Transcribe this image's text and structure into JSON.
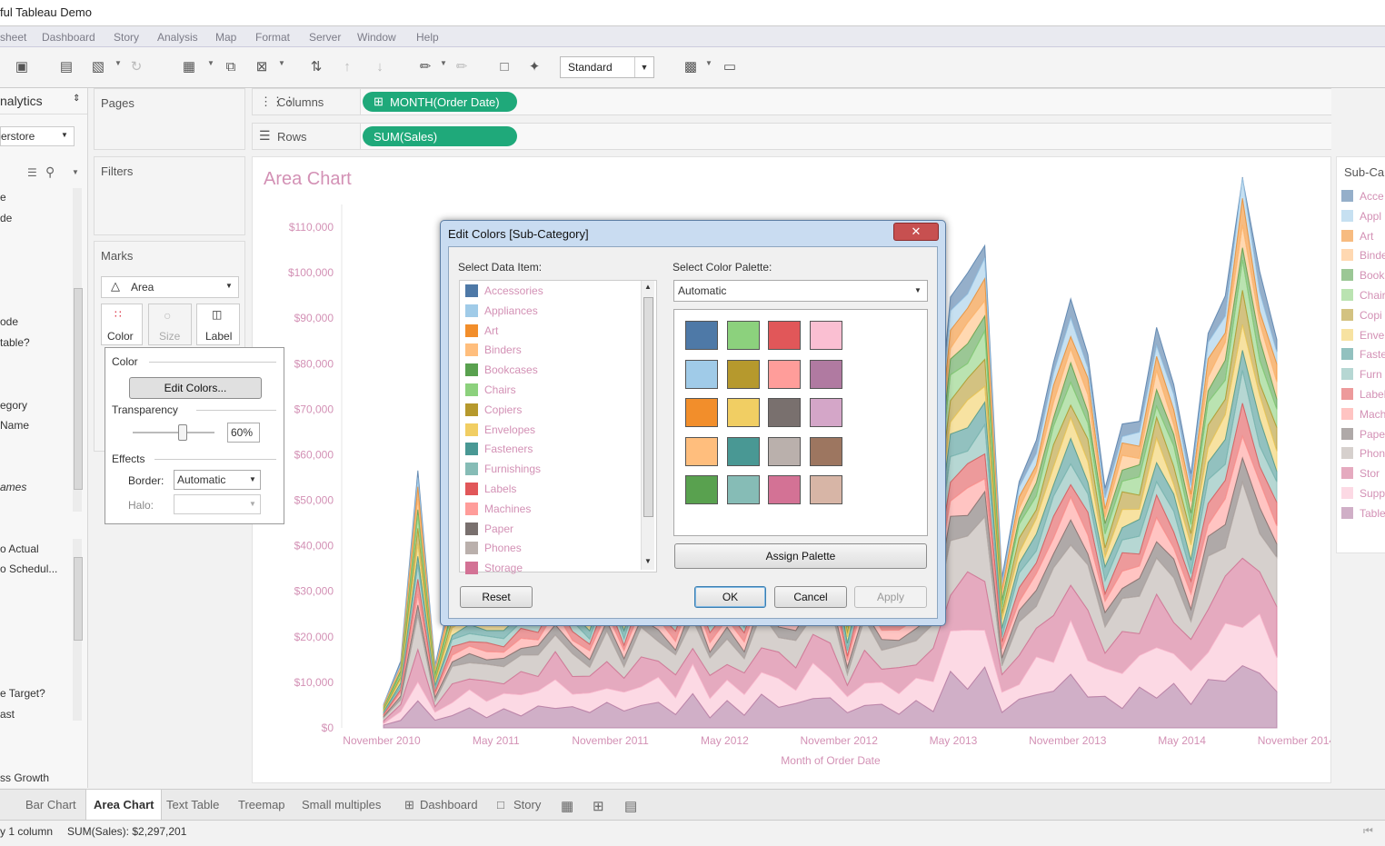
{
  "window": {
    "title": "ful Tableau Demo"
  },
  "menu": [
    "sheet",
    "Dashboard",
    "Story",
    "Analysis",
    "Map",
    "Format",
    "Server",
    "Window",
    "Help"
  ],
  "toolbar": {
    "fit": "Standard"
  },
  "datapane": {
    "tab": "nalytics",
    "datasource": "erstore",
    "fields": [
      "e",
      "de",
      "ode",
      "table?",
      "",
      "egory",
      "Name",
      "ames"
    ],
    "measures": [
      "o Actual",
      "o Schedul...",
      "e Target?",
      "ast",
      "ss Growth"
    ]
  },
  "shelves": {
    "pages": "Pages",
    "filters": "Filters",
    "columns_label": "Columns",
    "rows_label": "Rows",
    "columns_pill": "MONTH(Order Date)",
    "rows_pill": "SUM(Sales)"
  },
  "marks": {
    "title": "Marks",
    "type": "Area",
    "buttons": [
      "Color",
      "Size",
      "Label"
    ]
  },
  "color_popup": {
    "color_label": "Color",
    "edit_colors": "Edit Colors...",
    "transparency_label": "Transparency",
    "transparency_value": "60%",
    "transparency_fraction": 0.6,
    "effects_label": "Effects",
    "border_label": "Border:",
    "border_value": "Automatic",
    "halo_label": "Halo:"
  },
  "sheet": {
    "title": "Area Chart"
  },
  "chart_data": {
    "type": "area",
    "title": "Area Chart",
    "xlabel": "Month of Order Date",
    "ylabel": "",
    "x_ticks": [
      "November 2010",
      "May 2011",
      "November 2011",
      "May 2012",
      "November 2012",
      "May 2013",
      "November 2013",
      "May 2014",
      "November 2014"
    ],
    "y_ticks": [
      "$0",
      "$10,000",
      "$20,000",
      "$30,000",
      "$40,000",
      "$50,000",
      "$60,000",
      "$70,000",
      "$80,000",
      "$90,000",
      "$100,000",
      "$110,000"
    ],
    "ylim": [
      0,
      115000
    ],
    "stacked_total_approx": [
      5000,
      14000,
      55000,
      13000,
      30000,
      32000,
      32000,
      30000,
      37000,
      35000,
      47000,
      36000,
      31000,
      48000,
      30000,
      49000,
      42000,
      36000,
      54000,
      36000,
      43000,
      35000,
      55000,
      46000,
      43000,
      56000,
      60000,
      26000,
      53000,
      38000,
      41000,
      43000,
      53000,
      90000,
      97000,
      102000,
      32000,
      53000,
      60000,
      78000,
      89000,
      80000,
      50000,
      66000,
      64000,
      86000,
      72000,
      54000,
      84000,
      91000,
      121000,
      95000,
      83000
    ]
  },
  "legend": {
    "title": "Sub-Ca",
    "items": [
      {
        "label": "Acce",
        "color": "#4e79a7"
      },
      {
        "label": "Appl",
        "color": "#a0cbe8"
      },
      {
        "label": "Art",
        "color": "#f28e2b"
      },
      {
        "label": "Binde",
        "color": "#ffbe7d"
      },
      {
        "label": "Book",
        "color": "#59a14f"
      },
      {
        "label": "Chair",
        "color": "#8cd17d"
      },
      {
        "label": "Copi",
        "color": "#b6992d"
      },
      {
        "label": "Enve",
        "color": "#f1ce63"
      },
      {
        "label": "Faste",
        "color": "#499894"
      },
      {
        "label": "Furn",
        "color": "#86bcb6"
      },
      {
        "label": "Label",
        "color": "#e15759"
      },
      {
        "label": "Mach",
        "color": "#ff9d9a"
      },
      {
        "label": "Pape",
        "color": "#79706e"
      },
      {
        "label": "Phon",
        "color": "#bab0ac"
      },
      {
        "label": "Stor",
        "color": "#d37295"
      },
      {
        "label": "Supp",
        "color": "#fabfd2"
      },
      {
        "label": "Table",
        "color": "#b07aa1"
      }
    ]
  },
  "dialog": {
    "title": "Edit Colors [Sub-Category]",
    "select_item_label": "Select Data Item:",
    "palette_label": "Select Color Palette:",
    "palette_value": "Automatic",
    "items": [
      {
        "label": "Accessories",
        "color": "#4e79a7"
      },
      {
        "label": "Appliances",
        "color": "#a0cbe8"
      },
      {
        "label": "Art",
        "color": "#f28e2b"
      },
      {
        "label": "Binders",
        "color": "#ffbe7d"
      },
      {
        "label": "Bookcases",
        "color": "#59a14f"
      },
      {
        "label": "Chairs",
        "color": "#8cd17d"
      },
      {
        "label": "Copiers",
        "color": "#b6992d"
      },
      {
        "label": "Envelopes",
        "color": "#f1ce63"
      },
      {
        "label": "Fasteners",
        "color": "#499894"
      },
      {
        "label": "Furnishings",
        "color": "#86bcb6"
      },
      {
        "label": "Labels",
        "color": "#e15759"
      },
      {
        "label": "Machines",
        "color": "#ff9d9a"
      },
      {
        "label": "Paper",
        "color": "#79706e"
      },
      {
        "label": "Phones",
        "color": "#bab0ac"
      },
      {
        "label": "Storage",
        "color": "#d37295"
      }
    ],
    "palette_colors": [
      "#4e79a7",
      "#8cd17d",
      "#e15759",
      "#fabfd2",
      "#a0cbe8",
      "#b6992d",
      "#ff9d9a",
      "#b07aa1",
      "#f28e2b",
      "#f1ce63",
      "#79706e",
      "#d4a6c8",
      "#ffbe7d",
      "#499894",
      "#bab0ac",
      "#9d7660",
      "#59a14f",
      "#86bcb6",
      "#d37295",
      "#d7b5a6"
    ],
    "assign": "Assign Palette",
    "reset": "Reset",
    "ok": "OK",
    "cancel": "Cancel",
    "apply": "Apply"
  },
  "tabs": [
    "Bar Chart",
    "Area Chart",
    "Text Table",
    "Treemap",
    "Small multiples",
    "Dashboard",
    "Story"
  ],
  "active_tab": "Area Chart",
  "status": {
    "left": "y 1 column",
    "sum": "SUM(Sales): $2,297,201"
  }
}
